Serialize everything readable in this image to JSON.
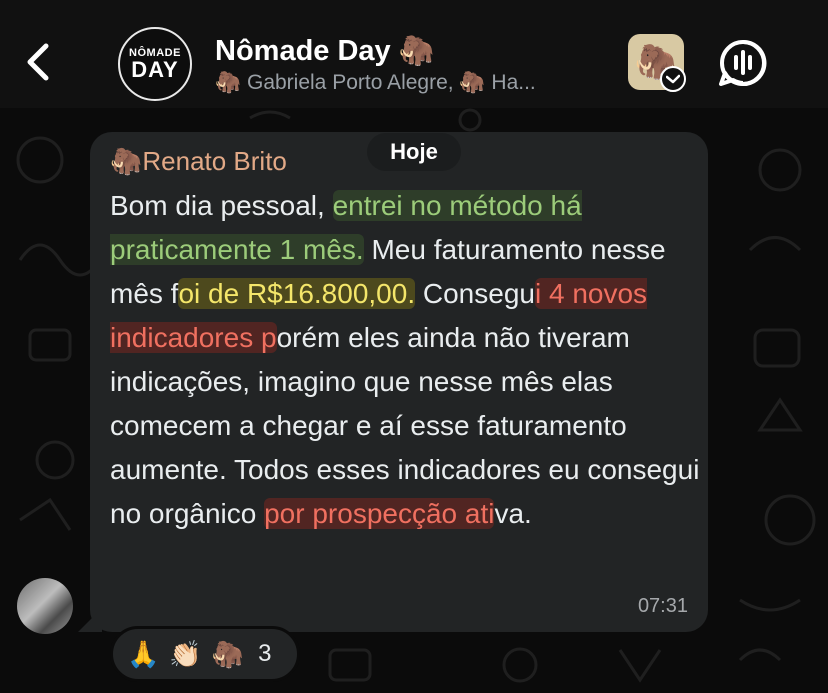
{
  "header": {
    "title": "Nômade Day 🦣",
    "subtitle": "🦣 Gabriela Porto Alegre, 🦣 Ha...",
    "avatar_top": "NÔMADE",
    "avatar_bottom": "DAY",
    "thumb_emoji": "🦣",
    "icons": [
      "back-chevron-icon",
      "voice-chat-icon",
      "checkmark-icon"
    ]
  },
  "date_pill": "Hoje",
  "message": {
    "sender": "🦣Renato Brito",
    "segments": [
      "Bom dia pessoal, ",
      "entrei no método há praticamente 1 mês.",
      " Meu faturamento nesse mês f",
      "oi de R$16.800,00.",
      " Consegu",
      "i 4 novos indicadores p",
      "orém eles ainda não tiveram indicações, imagino que nesse mês elas comecem a chegar e aí esse faturamento aumente. Todos esses indicadores eu consegui no orgânico ",
      "por prospecção ati",
      "va."
    ],
    "time": "07:31"
  },
  "reactions": {
    "emojis": [
      "🙏",
      "👏🏻",
      "🦣"
    ],
    "count": "3"
  },
  "colors": {
    "accent_sender": "#e2a987",
    "highlight_green": "#9ccc7a",
    "highlight_yellow": "#f4e66a",
    "highlight_red": "#f07060"
  }
}
